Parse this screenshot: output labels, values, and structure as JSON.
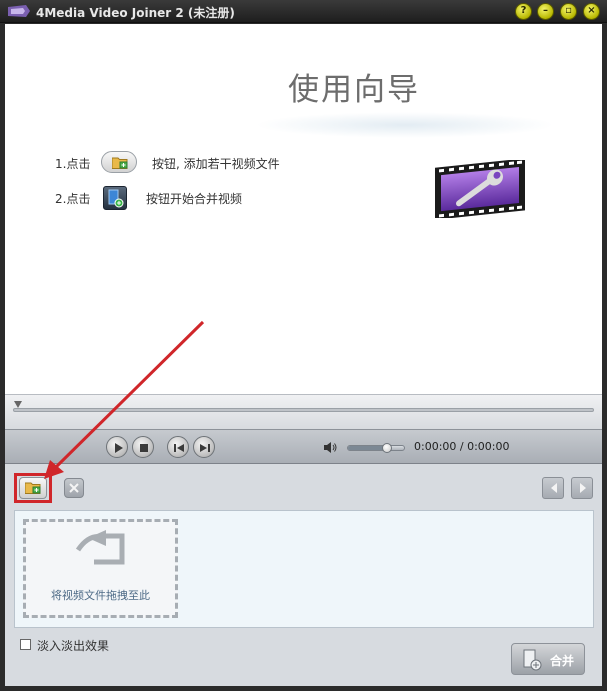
{
  "window": {
    "title": "4Media Video Joiner 2 (未注册)",
    "controls": [
      "help-icon",
      "minimize-icon",
      "restore-icon",
      "close-icon"
    ]
  },
  "guide": {
    "title": "使用向导",
    "step1_num": "1.点击",
    "step1_text": "按钮, 添加若干视频文件",
    "step2_num": "2.点击",
    "step2_text": "按钮开始合并视频"
  },
  "player": {
    "time": "0:00:00 / 0:00:00",
    "volume": 0.7,
    "buttons": [
      "play-icon",
      "stop-icon",
      "previous-icon",
      "next-icon"
    ]
  },
  "filelist": {
    "drop_text": "将视频文件拖拽至此"
  },
  "options": {
    "fade_label": "淡入淡出效果",
    "fade_checked": false
  },
  "actions": {
    "merge_label": "合并"
  },
  "colors": {
    "annotation": "#d0262a",
    "titlebar": "#1e1e1e",
    "panel": "#d7dbe0"
  }
}
